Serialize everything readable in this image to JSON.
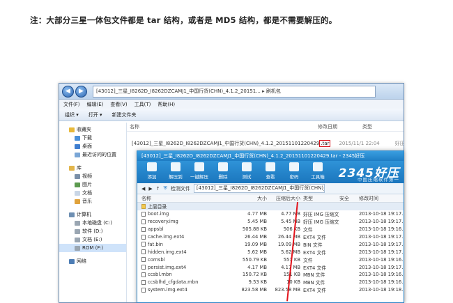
{
  "note": "注：大部分三星一体包文件都是 tar 结构，或者是 MD5 结构，都是不需要解压的。",
  "explorer": {
    "address": "[43012]_三星_I8262D_I8262DZCAMJ1_中国行货(CHN)_4.1.2_20151... ▸ 刷机包",
    "menu": [
      "文件(F)",
      "编辑(E)",
      "查看(V)",
      "工具(T)",
      "帮助(H)"
    ],
    "toolbar": [
      "组织 ▾",
      "打开 ▾",
      "新建文件夹"
    ],
    "columns": [
      "名称",
      "修改日期",
      "类型"
    ],
    "file": {
      "name_prefix": "[43012]_三星_I8262D_I8262DZCAMJ1_中国行货(CHN)_4.1.2_20151101220429",
      "name_ext": ".tar",
      "date": "2015/11/1 22:04",
      "type": "好压 TAR 压缩"
    },
    "sidebar": [
      {
        "label": "收藏夹",
        "level": 0,
        "color": "#e8b93a"
      },
      {
        "label": "下载",
        "level": 1,
        "color": "#4a90d9"
      },
      {
        "label": "桌面",
        "level": 1,
        "color": "#3f7ed0"
      },
      {
        "label": "最近访问的位置",
        "level": 1,
        "color": "#7aa6d6"
      },
      {
        "label": "库",
        "level": 0,
        "color": "#e2b54a",
        "gap": true
      },
      {
        "label": "视频",
        "level": 1,
        "color": "#7a8fa8"
      },
      {
        "label": "图片",
        "level": 1,
        "color": "#5c9a4f"
      },
      {
        "label": "文档",
        "level": 1,
        "color": "#c9d6e6"
      },
      {
        "label": "音乐",
        "level": 1,
        "color": "#e0a23b"
      },
      {
        "label": "计算机",
        "level": 0,
        "color": "#6e8fb2",
        "gap": true
      },
      {
        "label": "本地磁盘 (C:)",
        "level": 1,
        "color": "#9aa6b2"
      },
      {
        "label": "软件 (D:)",
        "level": 1,
        "color": "#9aa6b2"
      },
      {
        "label": "文档 (E:)",
        "level": 1,
        "color": "#9aa6b2"
      },
      {
        "label": "ROM (F:)",
        "level": 1,
        "color": "#9aa6b2",
        "selected": true
      },
      {
        "label": "网络",
        "level": 0,
        "color": "#4d7db5",
        "gap": true
      }
    ]
  },
  "archive": {
    "title": "[43012]_三星_I8262D_I8262DZCAMJ1_中国行货(CHN)_4.1.2_20151101220429.tar - 2345好压",
    "tools": [
      "添加",
      "解压到",
      "一键解压",
      "删除",
      "测试",
      "查看",
      "密码",
      "工具箱"
    ],
    "brand": "2345好压",
    "slogan": "中国压缩软件第一",
    "path_check": "检测文件",
    "path": "[43012]_三星_I8262D_I8262DZCAMJ1_中国行货(CHN)_4.1.2_201511...",
    "columns": [
      "名称",
      "大小",
      "压缩后大小",
      "类型",
      "安全",
      "修改时间"
    ],
    "up": "上层目录",
    "files": [
      {
        "name": "boot.img",
        "size": "4.77 MB",
        "csize": "4.77 MB",
        "type": "好压 IMG 压缩文件",
        "date": "2013-10-18 19:17..."
      },
      {
        "name": "recovery.img",
        "size": "5.45 MB",
        "csize": "5.45 MB",
        "type": "好压 IMG 压缩文件",
        "date": "2013-10-18 19:17..."
      },
      {
        "name": "appsbl",
        "size": "505.88 KB",
        "csize": "506 KB",
        "type": "文件",
        "date": "2013-10-18 19:16..."
      },
      {
        "name": "cache.img.ext4",
        "size": "26.44 MB",
        "csize": "26.44 MB",
        "type": "EXT4 文件",
        "date": "2013-10-18 19:17..."
      },
      {
        "name": "fat.bin",
        "size": "19.09 MB",
        "csize": "19.09 MB",
        "type": "BIN 文件",
        "date": "2013-10-18 19:17..."
      },
      {
        "name": "hidden.img.ext4",
        "size": "5.62 MB",
        "csize": "5.62 MB",
        "type": "EXT4 文件",
        "date": "2013-10-18 19:17..."
      },
      {
        "name": "cornsbl",
        "size": "550.79 KB",
        "csize": "551 KB",
        "type": "文件",
        "date": "2013-10-18 19:16..."
      },
      {
        "name": "persist.img.ext4",
        "size": "4.17 MB",
        "csize": "4.17 MB",
        "type": "EXT4 文件",
        "date": "2013-10-18 19:17..."
      },
      {
        "name": "ccsbl.mbn",
        "size": "150.72 KB",
        "csize": "151 KB",
        "type": "MBN 文件",
        "date": "2013-10-18 19:16..."
      },
      {
        "name": "ccsblhd_cfgdata.mbn",
        "size": "9.53 KB",
        "csize": "10 KB",
        "type": "MBN 文件",
        "date": "2013-10-18 19:16..."
      },
      {
        "name": "system.img.ext4",
        "size": "823.58 MB",
        "csize": "823.58 MB",
        "type": "EXT4 文件",
        "date": "2013-10-18 19:18..."
      }
    ]
  }
}
